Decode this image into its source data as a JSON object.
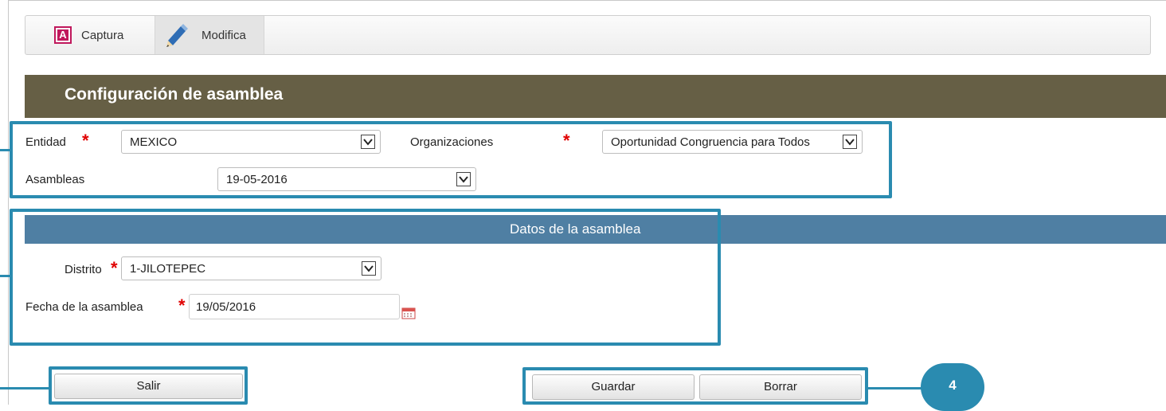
{
  "toolbar": {
    "captura_label": "Captura",
    "modifica_label": "Modifica"
  },
  "title": "Configuración de asamblea",
  "filters": {
    "entidad_label": "Entidad",
    "entidad_value": "MEXICO",
    "organizaciones_label": "Organizaciones",
    "organizaciones_value": "Oportunidad Congruencia para Todos",
    "asambleas_label": "Asambleas",
    "asambleas_value": "19-05-2016",
    "required_mark": "*"
  },
  "datos": {
    "header": "Datos de la asamblea",
    "distrito_label": "Distrito",
    "distrito_value": "1-JILOTEPEC",
    "fecha_label": "Fecha de la asamblea",
    "fecha_value": "19/05/2016"
  },
  "buttons": {
    "salir": "Salir",
    "guardar": "Guardar",
    "borrar": "Borrar"
  },
  "callout_number": "4",
  "colors": {
    "title_bar": "#665f45",
    "section_bar": "#4f7fa3",
    "highlight": "#2a8bb0",
    "required": "#e00000",
    "captura_icon": "#c0185c",
    "pencil_icon": "#2f6db5"
  }
}
